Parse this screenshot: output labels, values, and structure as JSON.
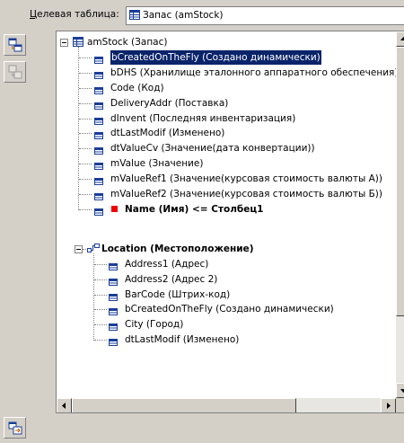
{
  "target": {
    "label_accel": "Ц",
    "label_rest": "елевая таблица:",
    "value": "Запас (amStock)"
  },
  "toolbar": {
    "icons": [
      "copy-field-icon",
      "copy-field-disabled-icon",
      "refresh-link-icon"
    ]
  },
  "tree": {
    "root": {
      "label": "amStock (Запас)"
    },
    "fields": [
      {
        "label": "bCreatedOnTheFly (Создано динамически)",
        "selected": true
      },
      {
        "label": "bDHS (Хранилище эталонного аппаратного обеспечения)"
      },
      {
        "label": "Code (Код)"
      },
      {
        "label": "DeliveryAddr (Поставка)"
      },
      {
        "label": "dInvent (Последняя инвентаризация)"
      },
      {
        "label": "dtLastModif (Изменено)"
      },
      {
        "label": "dtValueCv (Значение(дата конвертации))"
      },
      {
        "label": "mValue (Значение)"
      },
      {
        "label": "mValueRef1 (Значение(курсовая стоимость валюты А))"
      },
      {
        "label": "mValueRef2 (Значение(курсовая стоимость валюты Б))"
      },
      {
        "label": "Name (Имя)  <=  Столбец1",
        "bold": true,
        "mapped": true
      }
    ],
    "link": {
      "label": "Location (Местоположение)",
      "fields": [
        {
          "label": "Address1 (Адрес)"
        },
        {
          "label": "Address2 (Адрес 2)"
        },
        {
          "label": "BarCode (Штрих-код)"
        },
        {
          "label": "bCreatedOnTheFly (Создано динамически)"
        },
        {
          "label": "City (Город)"
        },
        {
          "label": "dtLastModif (Изменено)"
        }
      ]
    }
  }
}
